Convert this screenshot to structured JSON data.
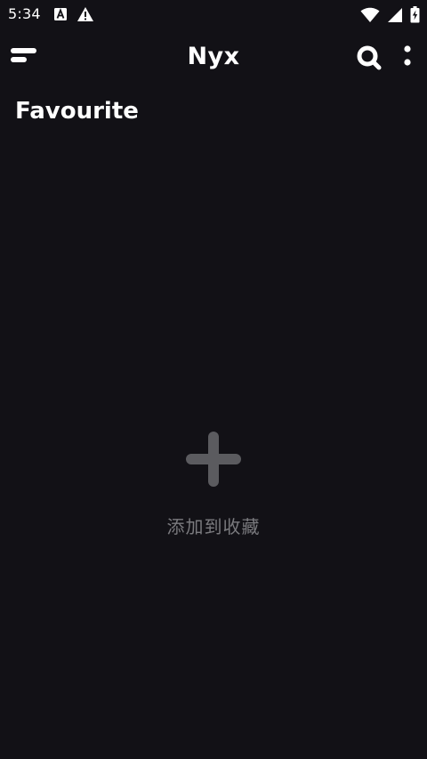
{
  "status_bar": {
    "time": "5:34",
    "left_icons": [
      "a-notification-icon",
      "warning-icon"
    ],
    "right_icons": [
      "wifi-icon",
      "signal-icon",
      "battery-charging-icon"
    ]
  },
  "app_bar": {
    "title": "Nyx",
    "icons": [
      "menu-icon",
      "search-icon",
      "more-vertical-icon"
    ]
  },
  "section": {
    "title": "Favourite"
  },
  "empty_state": {
    "icon": "plus-icon",
    "label": "添加到收藏",
    "icon_color": "#5b5b5f",
    "label_color": "#7a7a7e"
  },
  "colors": {
    "background": "#121116",
    "foreground": "#ffffff"
  }
}
